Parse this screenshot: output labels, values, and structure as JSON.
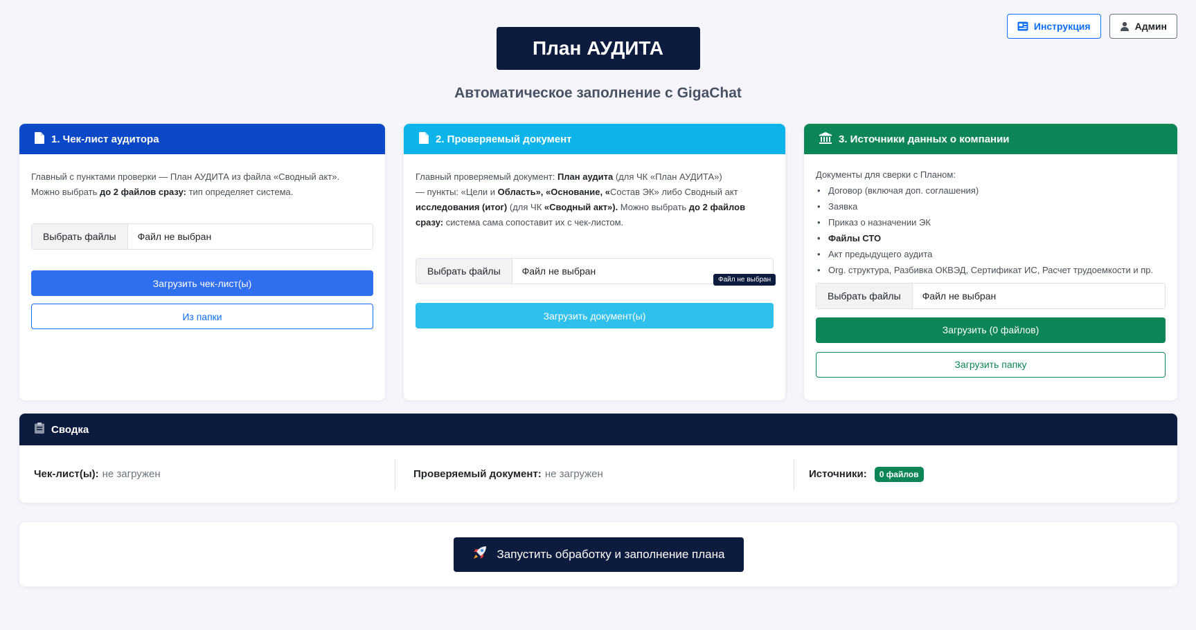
{
  "header": {
    "title": "План АУДИТА",
    "subtitle": "Автоматическое заполнение с GigaChat",
    "help_label": "Инструкция",
    "admin_label": "Админ"
  },
  "cards": {
    "checklist": {
      "title": "1. Чек-лист аудитора",
      "desc_1": "Главный с пунктами проверки — План АУДИТА из файла «Сводный акт».",
      "desc_2_pre": "Можно выбрать ",
      "desc_2_bold": "до 2 файлов сразу:",
      "desc_2_post": " тип определяет система.",
      "file_button": "Выбрать файлы",
      "file_status": "Файл не выбран",
      "upload_label": "Загрузить чек-лист(ы)",
      "folder_label": "Из папки"
    },
    "document": {
      "title": "2. Проверяемый документ",
      "d1": "Главный проверяемый документ: ",
      "d2": "План аудита",
      "d3": " (для ЧК «План АУДИТА»)",
      "d4": "— пункты: «Цели и ",
      "d5": "Область», «Основание, «",
      "d6": "Состав ЭК» либо Сводный акт",
      "d7": "исследования (итог)",
      "d8": " (для ЧК ",
      "d9": "«Сводный акт»).",
      "d10": " Можно выбрать ",
      "d11": "до 2 файлов",
      "d12": "сразу:",
      "d13": " система сама сопоставит их с чек-листом.",
      "file_button": "Выбрать файлы",
      "file_status": "Файл не выбран",
      "tooltip": "Файл не выбран",
      "upload_label": "Загрузить документ(ы)"
    },
    "sources": {
      "title": "3. Источники данных о компании",
      "intro": "Документы для сверки с Планом:",
      "items": [
        "Договор (включая доп. соглашения)",
        "Заявка",
        "Приказ о назначении ЭК",
        "Файлы СТО",
        "Акт предыдущего аудита",
        "Org. структура, Разбивка ОКВЭД, Сертификат ИС, Расчет трудоемкости и пр."
      ],
      "file_button": "Выбрать файлы",
      "file_status": "Файл не выбран",
      "upload_label": "Загрузить (0 файлов)",
      "folder_label": "Загрузить папку"
    }
  },
  "summary": {
    "title": "Сводка",
    "checklist_label": "Чек-лист(ы):",
    "checklist_value": "не загружен",
    "document_label": "Проверяемый документ:",
    "document_value": "не загружен",
    "sources_label": "Источники:",
    "sources_badge": "0 файлов"
  },
  "run": {
    "label": "Запустить обработку и заполнение плана"
  },
  "colors": {
    "navy": "#0d1b3e",
    "card1": "#0b48c7",
    "card2": "#0db4ea",
    "card3": "#0c8656",
    "primary": "#2f6ff0",
    "info": "#2fc0eb",
    "success": "#0c8656"
  },
  "icons": [
    "id-card-icon",
    "user-icon",
    "document-icon",
    "bank-icon",
    "clipboard-icon",
    "rocket-icon"
  ]
}
